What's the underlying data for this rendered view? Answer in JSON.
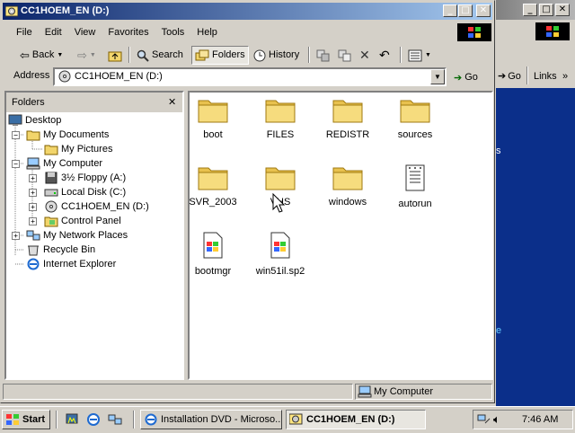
{
  "window": {
    "title": "CC1HOEM_EN (D:)",
    "controls": {
      "minimize": "_",
      "maximize": "□",
      "close": "✕"
    }
  },
  "menu": [
    "File",
    "Edit",
    "View",
    "Favorites",
    "Tools",
    "Help"
  ],
  "toolbar": {
    "back": "Back",
    "search": "Search",
    "folders": "Folders",
    "history": "History"
  },
  "address": {
    "label": "Address",
    "value": "CC1HOEM_EN (D:)",
    "go": "Go"
  },
  "folders_pane": {
    "title": "Folders",
    "close": "✕",
    "tree": [
      {
        "label": "Desktop",
        "icon": "desktop-icon"
      },
      {
        "label": "My Documents",
        "icon": "folder-icon"
      },
      {
        "label": "My Pictures",
        "icon": "folder-icon"
      },
      {
        "label": "My Computer",
        "icon": "computer-icon"
      },
      {
        "label": "3½ Floppy (A:)",
        "icon": "floppy-icon"
      },
      {
        "label": "Local Disk (C:)",
        "icon": "disk-icon"
      },
      {
        "label": "CC1HOEM_EN (D:)",
        "icon": "cdrom-icon"
      },
      {
        "label": "Control Panel",
        "icon": "control-panel-icon"
      },
      {
        "label": "My Network Places",
        "icon": "network-icon"
      },
      {
        "label": "Recycle Bin",
        "icon": "recycle-bin-icon"
      },
      {
        "label": "Internet Explorer",
        "icon": "internet-explorer-icon"
      }
    ]
  },
  "files": [
    {
      "name": "boot",
      "type": "folder"
    },
    {
      "name": "FILES",
      "type": "folder"
    },
    {
      "name": "REDISTR",
      "type": "folder"
    },
    {
      "name": "sources",
      "type": "folder"
    },
    {
      "name": "SVR_2003",
      "type": "folder"
    },
    {
      "name": "VHS",
      "type": "folder"
    },
    {
      "name": "windows",
      "type": "folder"
    },
    {
      "name": "autorun",
      "type": "text"
    },
    {
      "name": "bootmgr",
      "type": "file"
    },
    {
      "name": "win51il.sp2",
      "type": "file"
    }
  ],
  "status": {
    "location": "My Computer"
  },
  "background_window": {
    "go": "Go",
    "links": "Links",
    "text_fragments": [
      "s",
      "e"
    ]
  },
  "taskbar": {
    "start": "Start",
    "tasks": [
      "Installation DVD - Microso...",
      "CC1HOEM_EN (D:)"
    ],
    "clock": "7:46 AM"
  },
  "colors": {
    "title_active": "#0a246a",
    "title_gradient_end": "#a6caf0",
    "face": "#d4d0c8",
    "desktop_blue": "#0b2f8a",
    "folder": "#f2d56b"
  }
}
